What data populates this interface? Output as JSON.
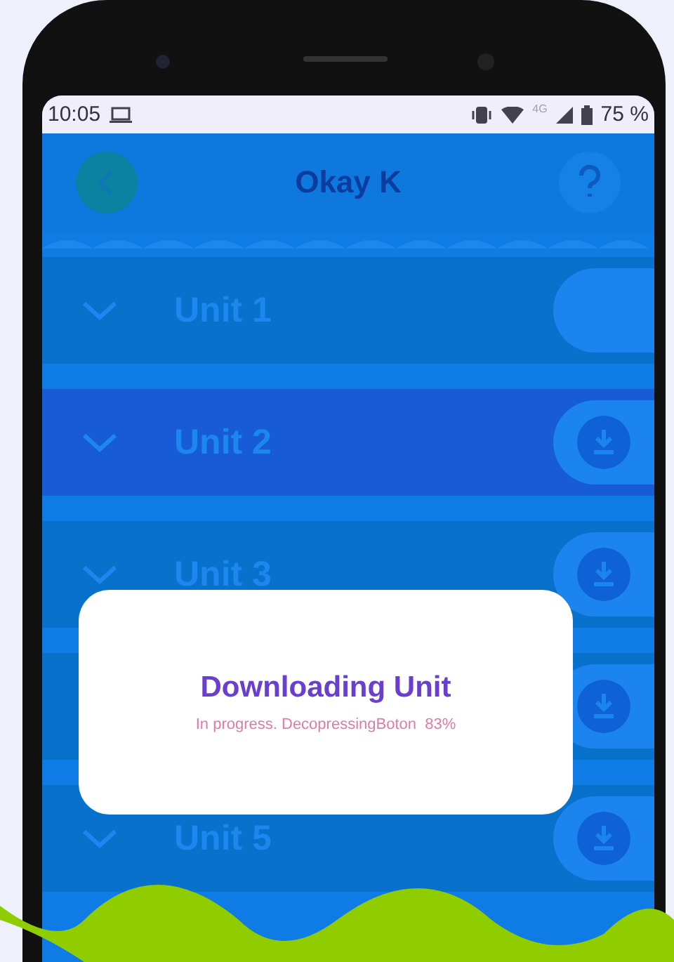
{
  "status_bar": {
    "time": "10:05",
    "network": "4G",
    "battery": "75 %"
  },
  "header": {
    "title": "Okay K"
  },
  "units": [
    {
      "label": "Unit 1",
      "selected": false,
      "kind": "plain"
    },
    {
      "label": "Unit 2",
      "selected": true,
      "kind": "download"
    },
    {
      "label": "Unit 3",
      "selected": false,
      "kind": "download"
    },
    {
      "selected": false,
      "kind": "download"
    },
    {
      "label": "Unit 5",
      "selected": false,
      "kind": "download"
    }
  ],
  "dialog": {
    "title": "Downloading Unit",
    "message": "In progress. DecopressingBoton  83%"
  }
}
